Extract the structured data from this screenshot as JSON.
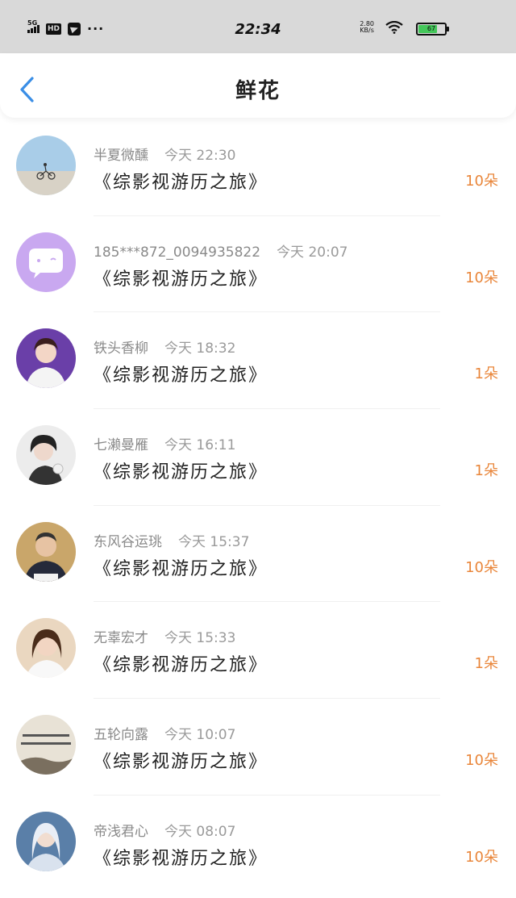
{
  "status_bar": {
    "network": "5G",
    "hd": "HD",
    "more": "···",
    "time": "22:34",
    "speed_value": "2.80",
    "speed_unit": "KB/s",
    "battery": "67"
  },
  "header": {
    "title": "鲜花"
  },
  "items": [
    {
      "user": "半夏微醺",
      "time": "今天 22:30",
      "book": "《综影视游历之旅》",
      "count": "10朵"
    },
    {
      "user": "185***872_0094935822",
      "time": "今天 20:07",
      "book": "《综影视游历之旅》",
      "count": "10朵"
    },
    {
      "user": "铁头香柳",
      "time": "今天 18:32",
      "book": "《综影视游历之旅》",
      "count": "1朵"
    },
    {
      "user": "七濑曼雁",
      "time": "今天 16:11",
      "book": "《综影视游历之旅》",
      "count": "1朵"
    },
    {
      "user": "东风谷运珧",
      "time": "今天 15:37",
      "book": "《综影视游历之旅》",
      "count": "10朵"
    },
    {
      "user": "无辜宏才",
      "time": "今天 15:33",
      "book": "《综影视游历之旅》",
      "count": "1朵"
    },
    {
      "user": "五轮向露",
      "time": "今天 10:07",
      "book": "《综影视游历之旅》",
      "count": "10朵"
    },
    {
      "user": "帝浅君心",
      "time": "今天 08:07",
      "book": "《综影视游历之旅》",
      "count": "10朵"
    }
  ],
  "colors": {
    "accent_count": "#e9863a",
    "back_arrow": "#3a8ee6",
    "status_bar_bg": "#d9d9d9",
    "battery_green": "#44c75a"
  }
}
